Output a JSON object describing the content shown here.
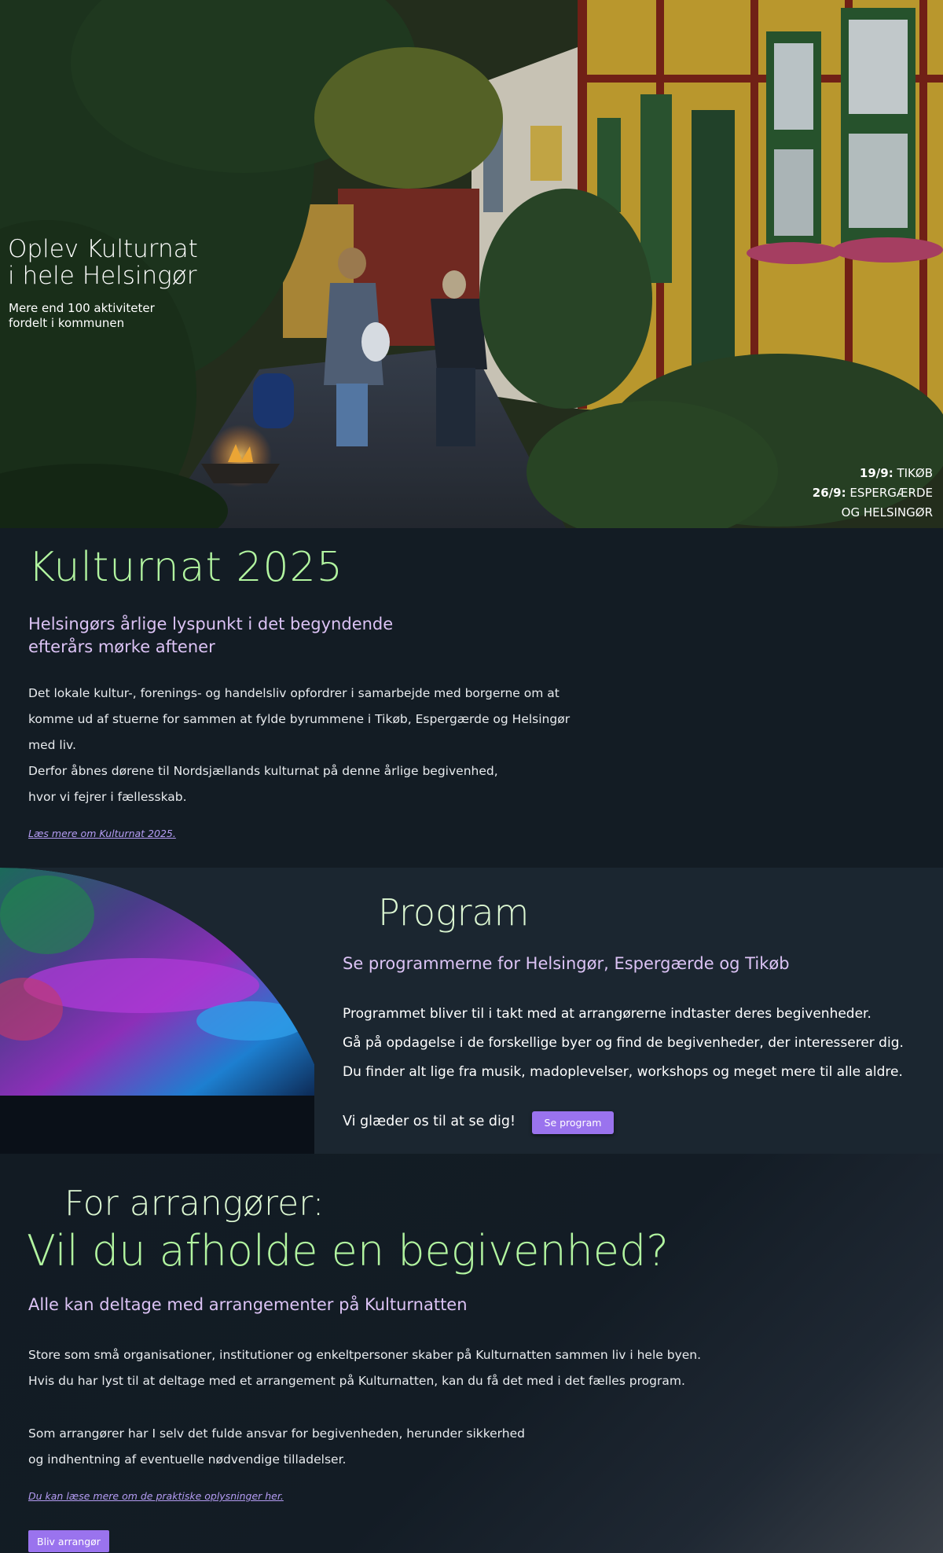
{
  "hero": {
    "title_line1": "Oplev Kulturnat",
    "title_line2": "i hele Helsingør",
    "sub_line1": "Mere end 100 aktiviteter",
    "sub_line2": "fordelt i kommunen",
    "dates": [
      {
        "date": "19/9:",
        "place": " TIKØB"
      },
      {
        "date": "26/9:",
        "place": " ESPERGÆRDE"
      },
      {
        "date": "",
        "place": "OG HELSINGØR"
      }
    ]
  },
  "intro": {
    "title": "Kulturnat 2025",
    "subtitle_line1": "Helsingørs årlige lyspunkt i det begyndende",
    "subtitle_line2": "efterårs mørke aftener",
    "body": [
      "Det lokale kultur-, forenings- og handelsliv opfordrer i samarbejde med borgerne om at",
      "komme ud af stuerne for sammen at fylde byrummene i Tikøb, Espergærde og Helsingør",
      "med liv.",
      "Derfor åbnes dørene til Nordsjællands kulturnat på denne årlige begivenhed,",
      "hvor vi fejrer i fællesskab."
    ],
    "link": "Læs mere om Kulturnat 2025."
  },
  "program": {
    "title": "Program",
    "subtitle": "Se programmerne for Helsingør, Espergærde og Tikøb",
    "body": [
      "Programmet bliver til i takt med at arrangørerne indtaster deres begivenheder.",
      "Gå på opdagelse i de forskellige byer og find de begivenheder, der interesserer dig.",
      "Du finder alt lige fra musik, madoplevelser, workshops og meget mere til alle aldre."
    ],
    "cta_text": "Vi glæder os til at se dig!",
    "button": "Se program"
  },
  "organizers": {
    "kicker": "For arrangører:",
    "title": "Vil du afholde en begivenhed?",
    "subtitle": "Alle kan deltage med arrangementer på Kulturnatten",
    "body1": [
      "Store som små organisationer, institutioner og enkeltpersoner skaber på Kulturnatten sammen liv i hele byen.",
      "Hvis du har lyst til at deltage med et arrangement på Kulturnatten, kan du få det med i det fælles program."
    ],
    "body2": [
      "Som arrangører har I selv det fulde ansvar for begivenheden, herunder sikkerhed",
      "og indhentning af eventuelle nødvendige tilladelser."
    ],
    "link": "Du kan læse mere om de praktiske oplysninger her.",
    "button": "Bliv arrangør"
  },
  "colors": {
    "background": "#131c24",
    "green_heading": "#b2f5a0",
    "lavender_heading": "#dcc3f5",
    "button": "#9a73ee",
    "link": "#b49cf3"
  }
}
